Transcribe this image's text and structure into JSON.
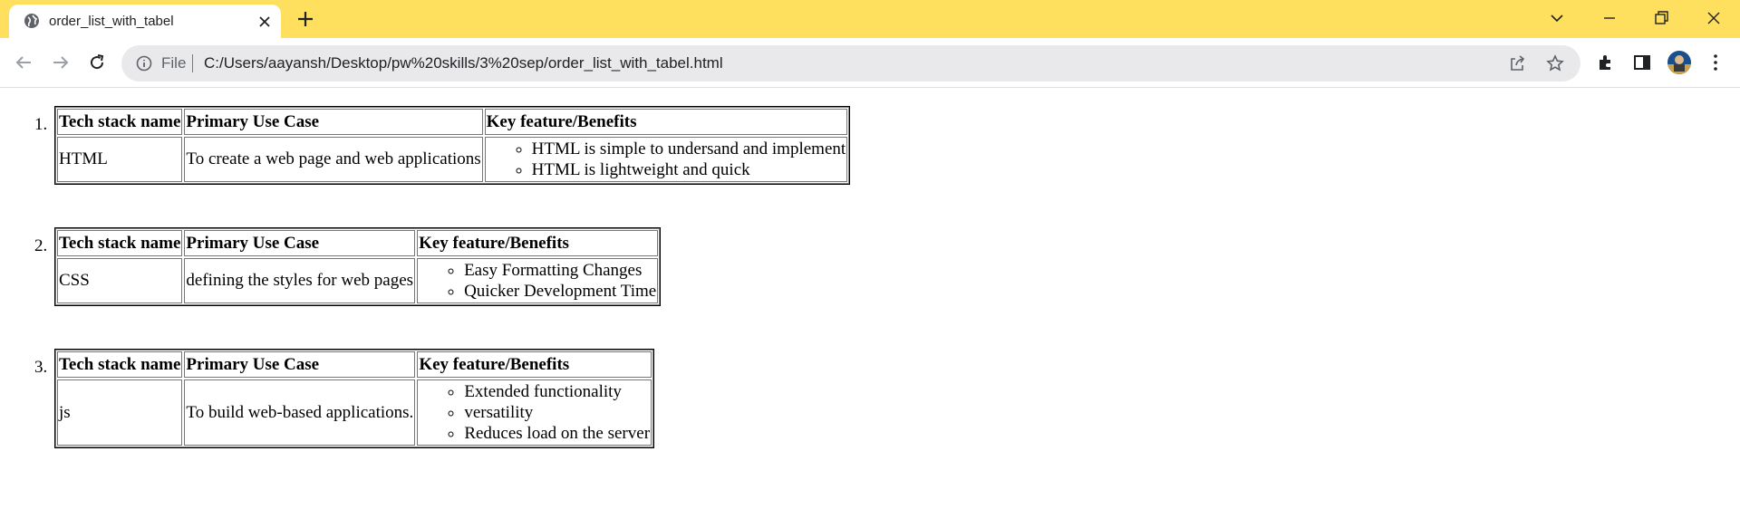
{
  "browser": {
    "tab_title": "order_list_with_tabel",
    "new_tab_label": "+",
    "omnibox": {
      "scheme_label": "File",
      "url": "C:/Users/aayansh/Desktop/pw%20skills/3%20sep/order_list_with_tabel.html"
    },
    "accent_color": "#ffe05e"
  },
  "page": {
    "headers": {
      "name": "Tech stack name",
      "use_case": "Primary Use Case",
      "features": "Key feature/Benefits"
    },
    "entries": [
      {
        "number": "1.",
        "name": "HTML",
        "use_case": "To create a web page and web applications",
        "features": [
          "HTML is simple to undersand and implement",
          "HTML is lightweight and quick"
        ]
      },
      {
        "number": "2.",
        "name": "CSS",
        "use_case": "defining the styles for web pages",
        "features": [
          "Easy Formatting Changes",
          "Quicker Development Time"
        ]
      },
      {
        "number": "3.",
        "name": "js",
        "use_case": "To build web-based applications.",
        "features": [
          "Extended functionality",
          "versatility",
          "Reduces load on the server"
        ]
      }
    ]
  }
}
